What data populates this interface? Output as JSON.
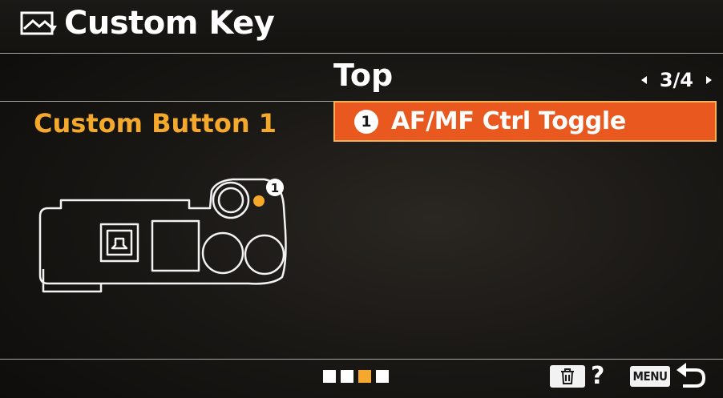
{
  "header": {
    "title": "Custom Key",
    "icon": "still-image-icon"
  },
  "tab": {
    "title": "Top",
    "page_indicator": "3/4"
  },
  "setting": {
    "label": "Custom Button 1",
    "badge_number": "1",
    "value": "AF/MF Ctrl Toggle"
  },
  "camera_diagram": {
    "badge_number": "1"
  },
  "footer": {
    "pages": [
      {
        "active": false
      },
      {
        "active": false
      },
      {
        "active": true
      },
      {
        "active": false
      }
    ],
    "help_label": "?",
    "menu_label": "MENU"
  },
  "colors": {
    "accent_orange": "#f4a92c",
    "selection_fill": "#e8581f",
    "selection_border": "#f6b25a",
    "background": "#1a1815"
  }
}
